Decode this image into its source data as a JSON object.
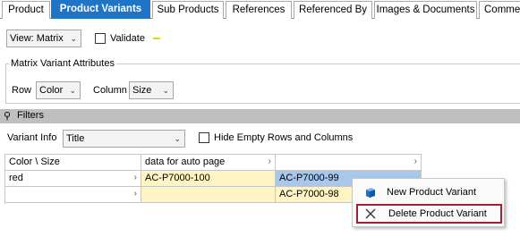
{
  "tabs": [
    {
      "label": "Product",
      "active": false
    },
    {
      "label": "Product Variants",
      "active": true
    },
    {
      "label": "Sub Products",
      "active": false
    },
    {
      "label": "References",
      "active": false
    },
    {
      "label": "Referenced By",
      "active": false
    },
    {
      "label": "Images & Documents",
      "active": false
    },
    {
      "label": "Comme",
      "active": false
    }
  ],
  "toolbar": {
    "view_value": "View: Matrix",
    "validate_label": "Validate",
    "validate_checked": false
  },
  "matrix_attributes": {
    "legend": "Matrix Variant Attributes",
    "row_label": "Row",
    "row_value": "Color",
    "column_label": "Column",
    "column_value": "Size"
  },
  "filters": {
    "title": "Filters",
    "variant_info_label": "Variant Info",
    "variant_info_value": "Title",
    "hide_empty_label": "Hide Empty Rows and Columns",
    "hide_empty_checked": false
  },
  "grid": {
    "header": [
      "Color \\ Size",
      "data for auto page",
      ""
    ],
    "rows": [
      [
        "red",
        "AC-P7000-100",
        "AC-P7000-99"
      ],
      [
        "",
        "",
        "AC-P7000-98"
      ]
    ]
  },
  "context_menu": {
    "items": [
      {
        "label": "New Product Variant",
        "icon": "cube-icon"
      },
      {
        "label": "Delete Product Variant",
        "icon": "delete-x-icon",
        "highlighted": true
      }
    ]
  },
  "colors": {
    "active_tab": "#1e74c7",
    "cell_yellow": "#fff5c4",
    "cell_selected": "#a9c7ea",
    "highlight_border": "#9b2335",
    "validate_marker": "#e6d800"
  }
}
